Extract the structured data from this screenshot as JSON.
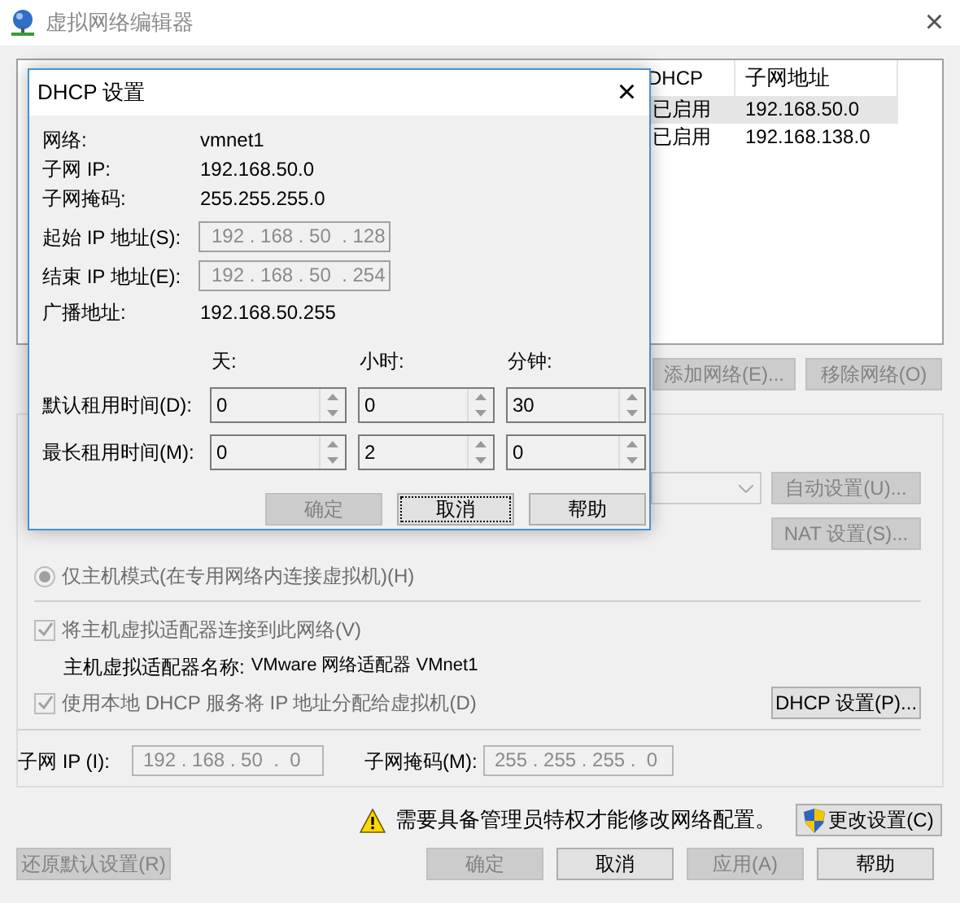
{
  "window": {
    "title": "虚拟网络编辑器",
    "close": "×"
  },
  "network_table": {
    "columns": [
      "DHCP",
      "子网地址"
    ],
    "rows": [
      {
        "cells": [
          "已启用",
          "192.168.50.0"
        ],
        "selected": true
      },
      {
        "cells": [
          "已启用",
          "192.168.138.0"
        ],
        "selected": false
      }
    ]
  },
  "table_buttons": [
    {
      "label": "添加网络(E)...",
      "disabled": true
    },
    {
      "label": "移除网络(O)",
      "disabled": true
    }
  ],
  "settings": {
    "auto_button": {
      "label": "自动设置(U)...",
      "disabled": true
    },
    "nat_button": {
      "label": "NAT 设置(S)...",
      "disabled": true
    },
    "radios": [
      {
        "label": "仅主机模式(在专用网络内连接虚拟机)(H)",
        "selected": true,
        "disabled": true
      }
    ],
    "connect_adapter": {
      "label": "将主机虚拟适配器连接到此网络(V)",
      "checked": true,
      "disabled": true
    },
    "adapter_name": {
      "label": "主机虚拟适配器名称:",
      "value": "VMware 网络适配器 VMnet1"
    },
    "use_dhcp": {
      "label": "使用本地 DHCP 服务将 IP 地址分配给虚拟机(D)",
      "checked": true,
      "disabled": true
    },
    "dhcp_button": {
      "label": "DHCP 设置(P)...",
      "disabled": false
    },
    "subnet_ip": {
      "label": "子网 IP (I):",
      "value": "192 . 168 . 50  .  0",
      "disabled": true
    },
    "subnet_mask": {
      "label": "子网掩码(M):",
      "value": "255 . 255 . 255 .  0",
      "disabled": true
    }
  },
  "warning": "需要具备管理员特权才能修改网络配置。",
  "change_button": {
    "label": "更改设置(C)",
    "disabled": false
  },
  "bottom_buttons": [
    {
      "label": "还原默认设置(R)",
      "disabled": true
    },
    {
      "label": "确定",
      "disabled": true
    },
    {
      "label": "取消",
      "disabled": false
    },
    {
      "label": "应用(A)",
      "disabled": true
    },
    {
      "label": "帮助",
      "disabled": false
    }
  ],
  "dhcp_dialog": {
    "title": "DHCP 设置",
    "close": "×",
    "info": [
      {
        "label": "网络:",
        "value": "vmnet1"
      },
      {
        "label": "子网 IP:",
        "value": "192.168.50.0"
      },
      {
        "label": "子网掩码:",
        "value": "255.255.255.0"
      }
    ],
    "ranges": [
      {
        "label": "起始 IP 地址(S):",
        "value": "192 . 168 . 50  . 128",
        "disabled": true
      },
      {
        "label": "结束 IP 地址(E):",
        "value": "192 . 168 . 50  . 254",
        "disabled": true
      }
    ],
    "broadcast": {
      "label": "广播地址:",
      "value": "192.168.50.255"
    },
    "lease_headers": [
      "天:",
      "小时:",
      "分钟:"
    ],
    "leases": [
      {
        "label": "默认租用时间(D):",
        "values": [
          "0",
          "0",
          "30"
        ]
      },
      {
        "label": "最长租用时间(M):",
        "values": [
          "0",
          "2",
          "0"
        ]
      }
    ],
    "buttons": [
      {
        "label": "确定",
        "disabled": true,
        "focused": false
      },
      {
        "label": "取消",
        "disabled": false,
        "focused": true
      },
      {
        "label": "帮助",
        "disabled": false,
        "focused": false
      }
    ]
  }
}
